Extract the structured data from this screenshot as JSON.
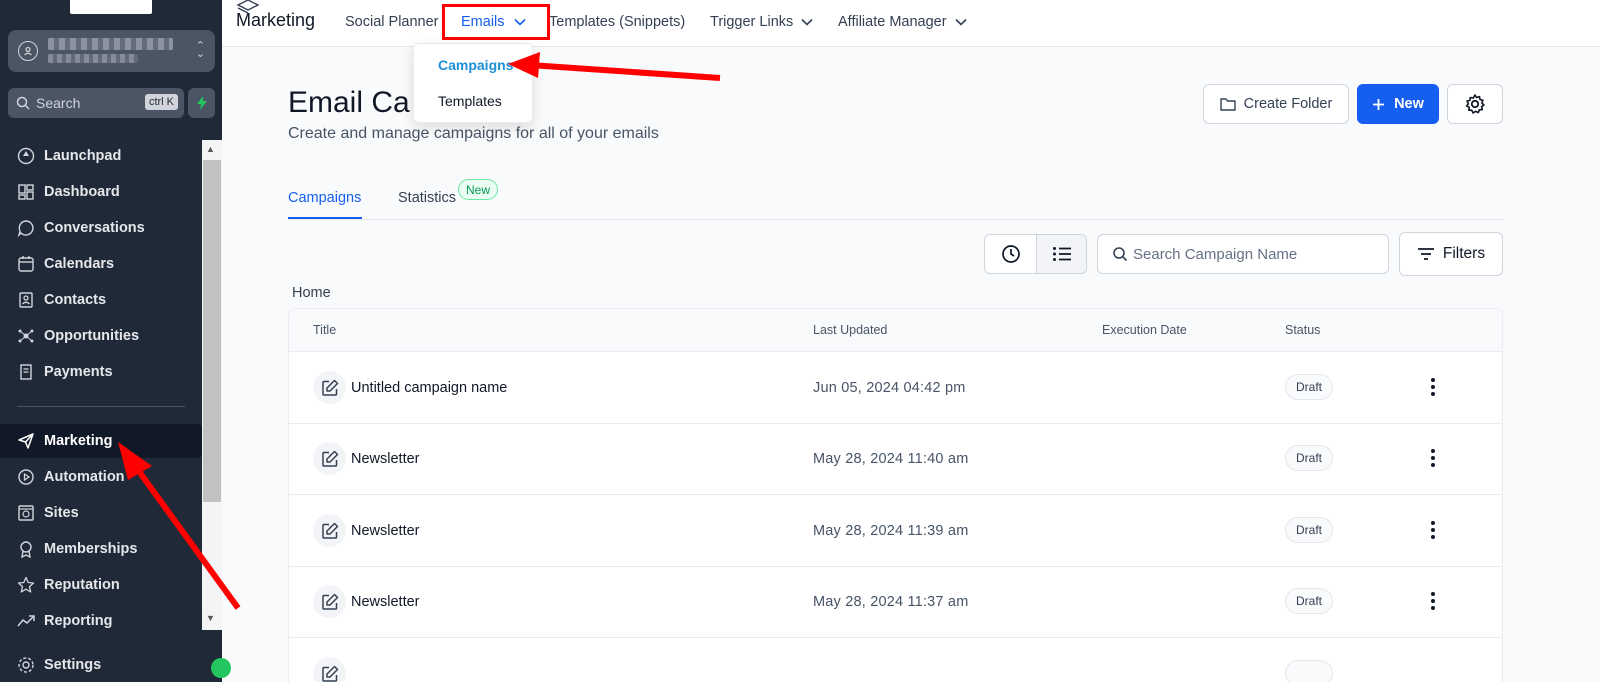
{
  "sidebar": {
    "search_placeholder": "Search",
    "search_shortcut": "ctrl K",
    "items": [
      {
        "label": "Launchpad",
        "icon": "rocket-icon"
      },
      {
        "label": "Dashboard",
        "icon": "grid-icon"
      },
      {
        "label": "Conversations",
        "icon": "chat-icon"
      },
      {
        "label": "Calendars",
        "icon": "calendar-icon"
      },
      {
        "label": "Contacts",
        "icon": "contacts-icon"
      },
      {
        "label": "Opportunities",
        "icon": "hub-icon"
      },
      {
        "label": "Payments",
        "icon": "receipt-icon"
      },
      {
        "label": "Marketing",
        "icon": "send-icon",
        "active": true
      },
      {
        "label": "Automation",
        "icon": "play-circle-icon"
      },
      {
        "label": "Sites",
        "icon": "globe-icon"
      },
      {
        "label": "Memberships",
        "icon": "award-icon"
      },
      {
        "label": "Reputation",
        "icon": "star-icon"
      },
      {
        "label": "Reporting",
        "icon": "trend-icon"
      },
      {
        "label": "Settings",
        "icon": "gear-icon"
      }
    ]
  },
  "topnav": {
    "brand": "Marketing",
    "links": [
      "Social Planner",
      "Emails",
      "Templates (Snippets)",
      "Trigger Links",
      "Affiliate Manager"
    ],
    "active": "Emails"
  },
  "dropdown": {
    "items": [
      "Campaigns",
      "Templates"
    ]
  },
  "page": {
    "title": "Email Ca",
    "subtitle": "Create and manage campaigns for all of your emails",
    "create_folder": "Create Folder",
    "new": "New",
    "tabs": [
      "Campaigns",
      "Statistics"
    ],
    "tab_badge": "New",
    "search_placeholder": "Search Campaign Name",
    "filters": "Filters",
    "breadcrumb": "Home"
  },
  "table": {
    "headers": [
      "Title",
      "Last Updated",
      "Execution Date",
      "Status"
    ],
    "rows": [
      {
        "title": "Untitled campaign name",
        "updated": "Jun 05, 2024 04:42 pm",
        "status": "Draft"
      },
      {
        "title": "Newsletter",
        "updated": "May 28, 2024 11:40 am",
        "status": "Draft"
      },
      {
        "title": "Newsletter",
        "updated": "May 28, 2024 11:39 am",
        "status": "Draft"
      },
      {
        "title": "Newsletter",
        "updated": "May 28, 2024 11:37 am",
        "status": "Draft"
      }
    ]
  },
  "colors": {
    "accent": "#155eef",
    "sidebar": "#1f2937",
    "annotation": "#ff0000"
  }
}
